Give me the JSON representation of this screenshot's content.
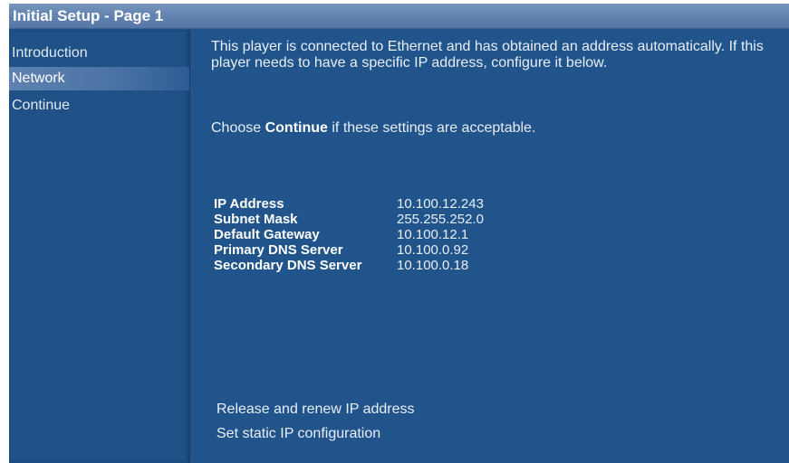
{
  "window": {
    "title": "Initial Setup - Page 1"
  },
  "sidebar": {
    "items": [
      {
        "label": "Introduction",
        "selected": false
      },
      {
        "label": "Network",
        "selected": true
      },
      {
        "label": "Continue",
        "selected": false
      }
    ]
  },
  "main": {
    "intro_text": "This player is connected to Ethernet and has obtained an address automatically. If this player needs to have a specific IP address, configure it below.",
    "choose_prefix": "Choose ",
    "choose_bold": "Continue",
    "choose_suffix": " if these settings are acceptable.",
    "network": [
      {
        "label": "IP Address",
        "value": "10.100.12.243"
      },
      {
        "label": "Subnet Mask",
        "value": "255.255.252.0"
      },
      {
        "label": "Default Gateway",
        "value": "10.100.12.1"
      },
      {
        "label": "Primary DNS Server",
        "value": "10.100.0.92"
      },
      {
        "label": "Secondary DNS Server",
        "value": "10.100.0.18"
      }
    ],
    "actions": {
      "release_renew": "Release and renew IP address",
      "set_static": "Set static IP configuration"
    }
  },
  "colors": {
    "background": "#21548a",
    "title_bar": "#6485b2",
    "selected_item": "#4a72a4",
    "text": "#e8eef6"
  }
}
